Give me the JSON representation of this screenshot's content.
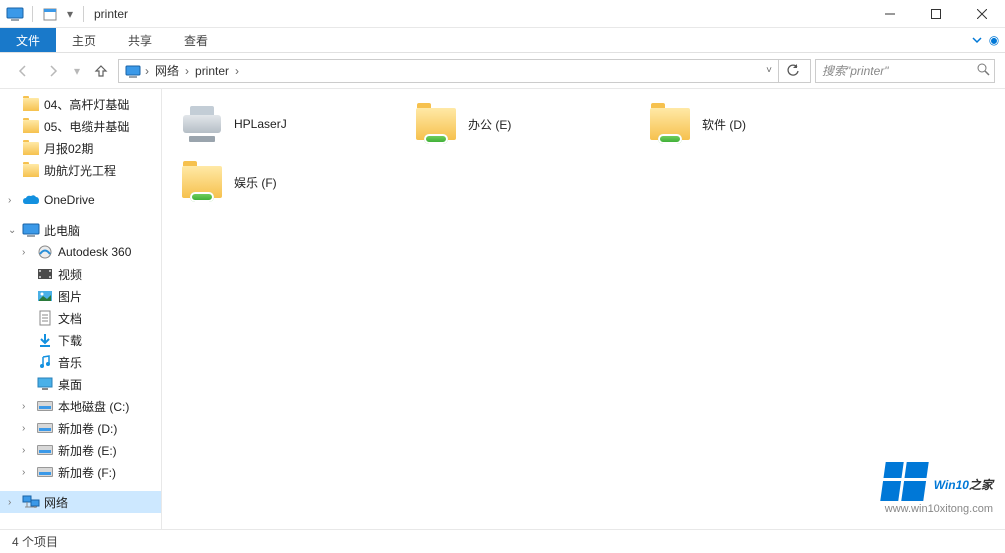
{
  "window": {
    "title": "printer"
  },
  "ribbon": {
    "file": "文件",
    "tabs": [
      "主页",
      "共享",
      "查看"
    ]
  },
  "address": {
    "crumbs": [
      "网络",
      "printer"
    ],
    "search_placeholder": "搜索\"printer\""
  },
  "sidebar": {
    "quick": [
      {
        "label": "04、高杆灯基础"
      },
      {
        "label": "05、电缆井基础"
      },
      {
        "label": "月报02期"
      },
      {
        "label": "助航灯光工程"
      }
    ],
    "onedrive": "OneDrive",
    "thispc": {
      "label": "此电脑",
      "children": [
        {
          "label": "Autodesk 360",
          "icon": "a360"
        },
        {
          "label": "视频",
          "icon": "video"
        },
        {
          "label": "图片",
          "icon": "pictures"
        },
        {
          "label": "文档",
          "icon": "docs"
        },
        {
          "label": "下载",
          "icon": "download"
        },
        {
          "label": "音乐",
          "icon": "music"
        },
        {
          "label": "桌面",
          "icon": "desktop"
        },
        {
          "label": "本地磁盘 (C:)",
          "icon": "disk"
        },
        {
          "label": "新加卷 (D:)",
          "icon": "disk"
        },
        {
          "label": "新加卷 (E:)",
          "icon": "disk"
        },
        {
          "label": "新加卷 (F:)",
          "icon": "disk"
        }
      ]
    },
    "network": "网络"
  },
  "content": {
    "items": [
      {
        "label": "HPLaserJ",
        "type": "printer"
      },
      {
        "label": "办公 (E)",
        "type": "share"
      },
      {
        "label": "软件 (D)",
        "type": "share"
      },
      {
        "label": "娱乐 (F)",
        "type": "share"
      }
    ]
  },
  "statusbar": {
    "text": "4 个项目"
  },
  "watermark": {
    "brand_a": "Win10",
    "brand_b": "之家",
    "url": "www.win10xitong.com"
  }
}
